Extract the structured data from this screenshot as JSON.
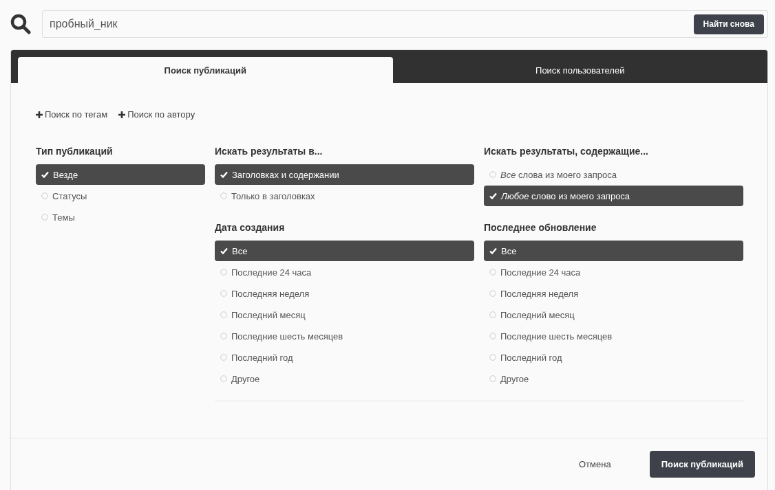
{
  "search": {
    "value": "пробный_ник",
    "button": "Найти снова"
  },
  "tabs": [
    {
      "label": "Поиск публикаций",
      "selected": true
    },
    {
      "label": "Поиск пользователей",
      "selected": false
    }
  ],
  "filter_links": [
    "Поиск по тегам",
    "Поиск по автору"
  ],
  "columns": [
    {
      "groups": [
        {
          "title": "Тип публикаций",
          "options": [
            {
              "label": "Везде",
              "selected": true
            },
            {
              "label": "Статусы",
              "selected": false
            },
            {
              "label": "Темы",
              "selected": false
            }
          ]
        }
      ]
    },
    {
      "groups": [
        {
          "title": "Искать результаты в...",
          "options": [
            {
              "label": "Заголовках и содержании",
              "selected": true
            },
            {
              "label": "Только в заголовках",
              "selected": false
            }
          ]
        },
        {
          "title": "Дата создания",
          "options": [
            {
              "label": "Все",
              "selected": true
            },
            {
              "label": "Последние 24 часа",
              "selected": false
            },
            {
              "label": "Последняя неделя",
              "selected": false
            },
            {
              "label": "Последний месяц",
              "selected": false
            },
            {
              "label": "Последние шесть месяцев",
              "selected": false
            },
            {
              "label": "Последний год",
              "selected": false
            },
            {
              "label": "Другое",
              "selected": false
            }
          ]
        }
      ]
    },
    {
      "groups": [
        {
          "title": "Искать результаты, содержащие...",
          "options": [
            {
              "label": "*Все* слова из моего запроса",
              "selected": false
            },
            {
              "label": "*Любое* слово из моего запроса",
              "selected": true
            }
          ]
        },
        {
          "title": "Последнее обновление",
          "options": [
            {
              "label": "Все",
              "selected": true
            },
            {
              "label": "Последние 24 часа",
              "selected": false
            },
            {
              "label": "Последняя неделя",
              "selected": false
            },
            {
              "label": "Последний месяц",
              "selected": false
            },
            {
              "label": "Последние шесть месяцев",
              "selected": false
            },
            {
              "label": "Последний год",
              "selected": false
            },
            {
              "label": "Другое",
              "selected": false
            }
          ]
        }
      ]
    }
  ],
  "footer": {
    "cancel": "Отмена",
    "submit": "Поиск публикаций"
  }
}
